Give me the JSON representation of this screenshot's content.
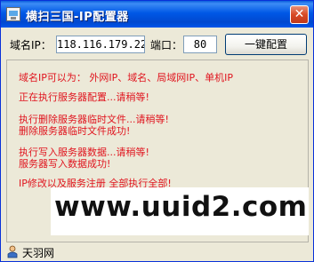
{
  "window": {
    "title": "横扫三国-IP配置器",
    "close_glyph": "✕"
  },
  "form": {
    "ip_label": "域名IP：",
    "ip_value": "118.116.179.22",
    "port_label": "端口：",
    "port_value": "80",
    "configure_button": "一键配置"
  },
  "log": {
    "lines": [
      "域名IP可以为： 外网IP、域名、局域网IP、单机IP",
      "正在执行服务器配置...请稍等!",
      "执行删除服务器临时文件...请稍等!",
      "删除服务器临时文件成功!",
      "执行写入服务器数据...请稍等!",
      "服务器写入数据成功!",
      "IP修改以及服务注册 全部执行全部!"
    ],
    "text_color": "#e0141e"
  },
  "watermark": {
    "text": "www.uuid2.com"
  },
  "statusbar": {
    "text": "天羽网"
  },
  "icons": {
    "app": "window-app-icon",
    "close": "close-icon",
    "status": "person-icon"
  }
}
